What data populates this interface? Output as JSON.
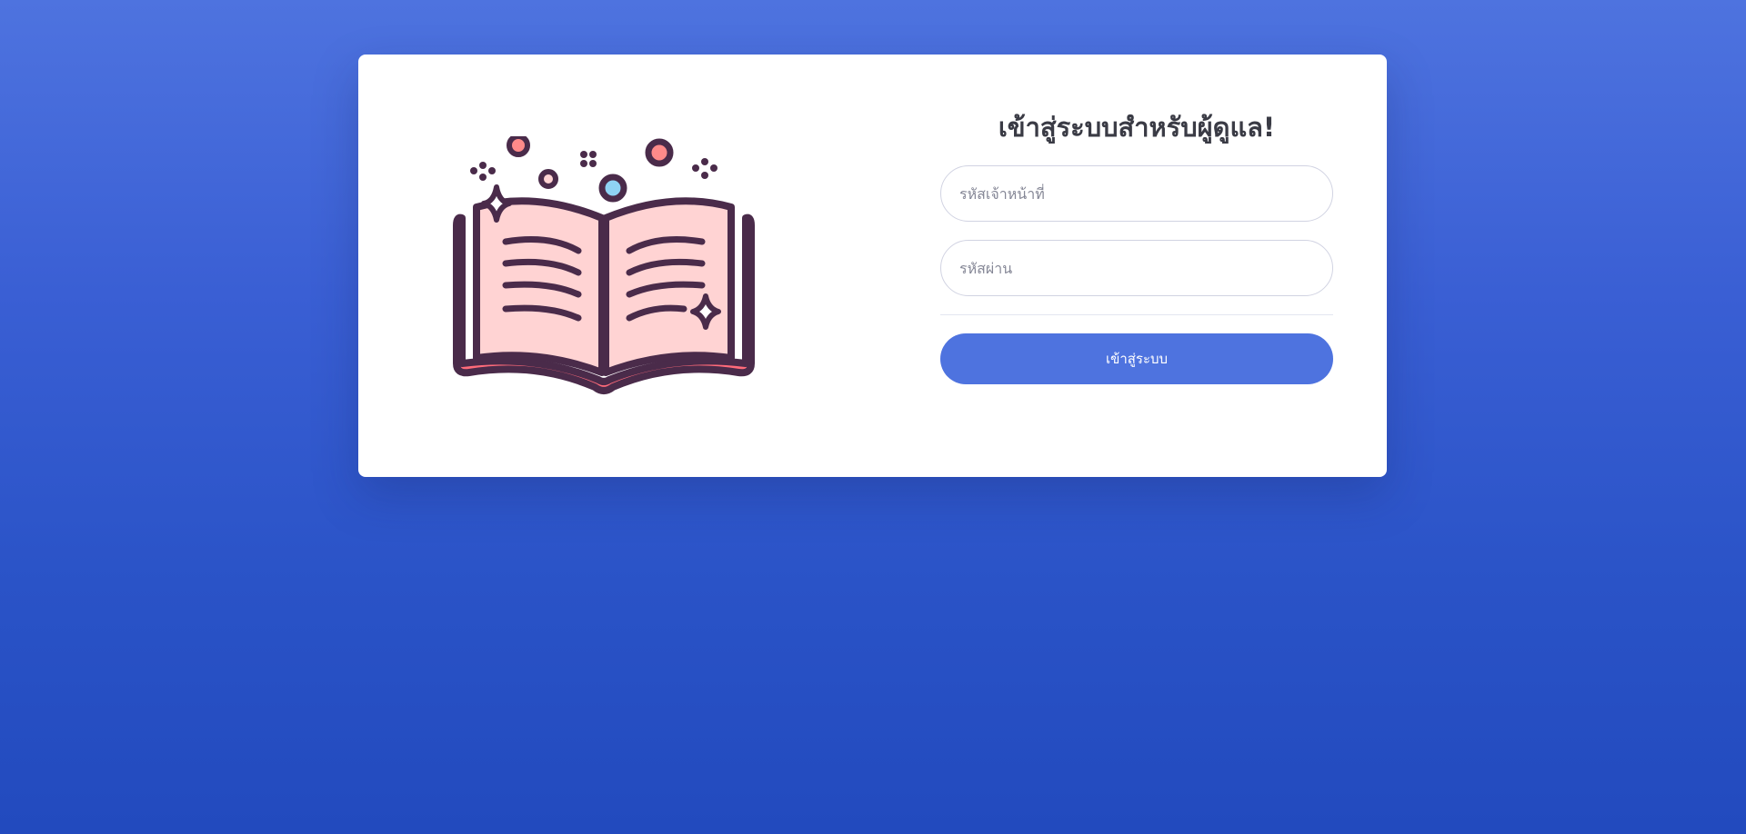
{
  "form": {
    "title": "เข้าสู่ระบบสำหรับผู้ดูแล!",
    "officer_id_placeholder": "รหัสเจ้าหน้าที่",
    "password_placeholder": "รหัสผ่าน",
    "login_label": "เข้าสู่ระบบ"
  },
  "illustration": {
    "icon": "open-book-icon"
  },
  "colors": {
    "background_top": "#4e73df",
    "background_bottom": "#224abe",
    "button": "#4e73df",
    "book_cover": "#ff6b7a",
    "book_pages": "#ffd3d3",
    "book_outline": "#4a2b4a",
    "sparkle_blue": "#8fd3f4"
  }
}
